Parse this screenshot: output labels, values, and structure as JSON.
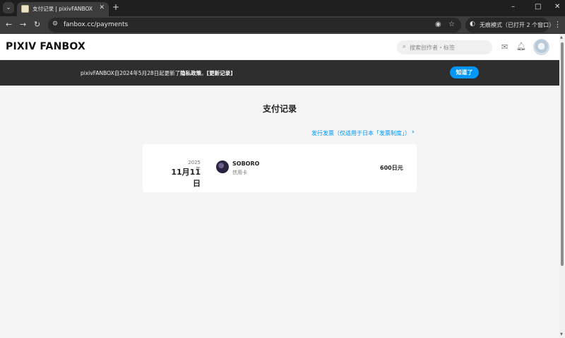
{
  "browser": {
    "tab_menu_icon": "⌄",
    "tab_title": "支付记录 | pixivFANBOX",
    "new_tab_icon": "+",
    "window_controls": {
      "minimize": "–",
      "maximize": "□",
      "close": "✕"
    },
    "back_icon": "←",
    "forward_icon": "→",
    "reload_icon": "↻",
    "url": "fanbox.cc/payments",
    "incognito_label": "无痕模式（已打开 2 个窗口）",
    "menu_icon": "⋮"
  },
  "header": {
    "logo": "PIXIV FANBOX",
    "search_placeholder": "搜索创作者・标签"
  },
  "notice": {
    "text_prefix": "pixivFANBOX自2024年5月28日起更新了",
    "policy_link": "隐私政策",
    "sep": "。",
    "history_link": "[更新记录]",
    "ok_button": "知道了"
  },
  "main": {
    "title": "支付记录",
    "invoice_link": "发行发票（仅适用于日本「发票制度」）"
  },
  "payments": [
    {
      "year": "2025年",
      "date": "11月11日",
      "creator": "SOBORO",
      "method": "信用卡",
      "amount": "600日元"
    }
  ],
  "colors": {
    "accent": "#0096fa",
    "banner": "#2e2e2e",
    "background": "#f5f5f5"
  }
}
